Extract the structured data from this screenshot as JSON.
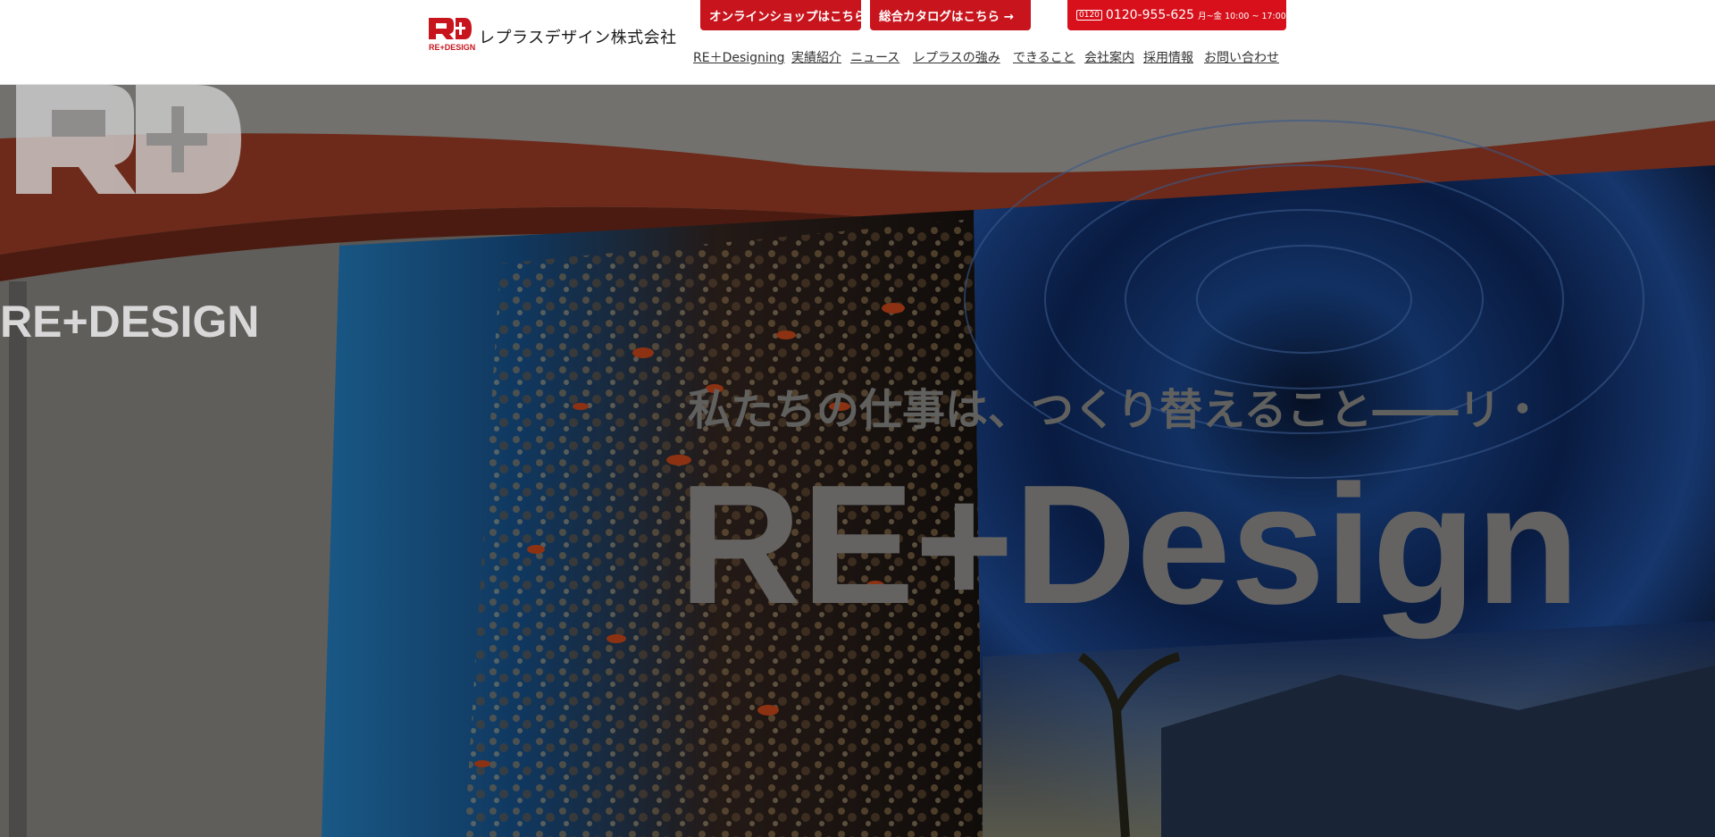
{
  "header": {
    "company_name": "レプラスデザイン株式会社",
    "logo_text": "RE+DESIGN",
    "shop_button": "オンラインショップはこちら→",
    "catalog_button": "総合カタログはこちら →",
    "phone": {
      "icon": "free-dial-icon",
      "icon_text": "0120",
      "number": "0120-955-625",
      "hours": "月~金 10:00 ~ 17:00"
    },
    "nav": [
      "RE＋Designing",
      "実績紹介",
      "ニュース",
      "レプラスの強み",
      "できること",
      "会社案内",
      "採用情報",
      "お問い合わせ"
    ]
  },
  "hero": {
    "banner_tagline": "私たちの仕事は、つくり替えること――リ・",
    "banner_word": "RE+Design",
    "logo_text": "RE+DESIGN"
  },
  "colors": {
    "brand_red": "#c8141d",
    "phone_red": "#d7101b",
    "nav_text": "#333333",
    "header_bg": "#ffffff"
  }
}
